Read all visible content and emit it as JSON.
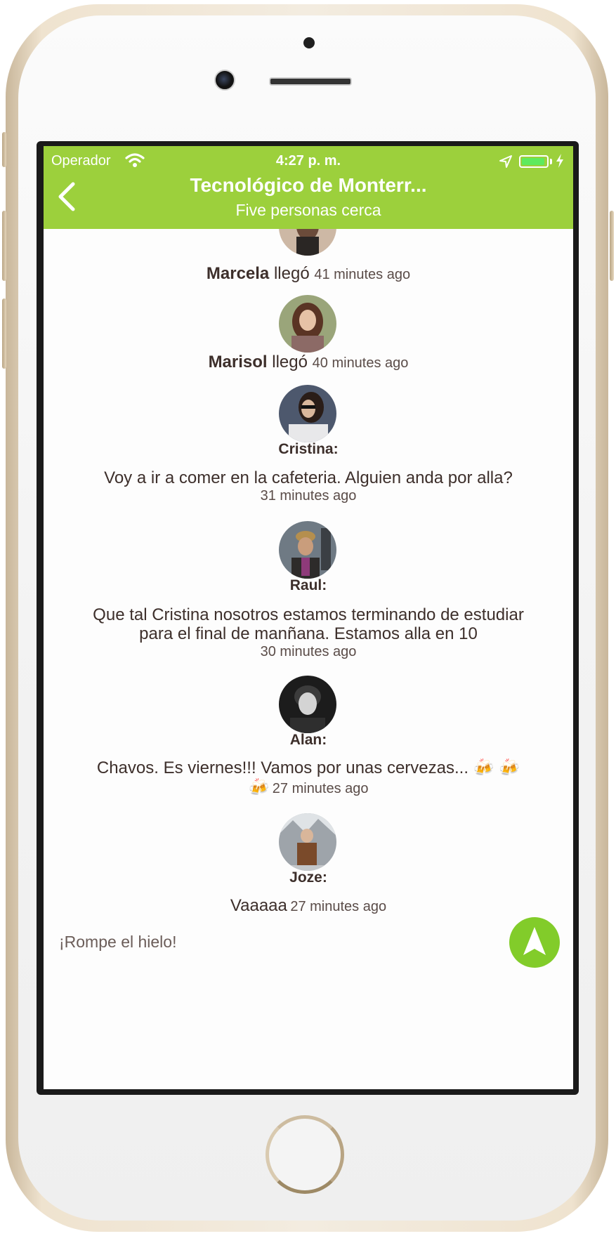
{
  "status_bar": {
    "carrier": "Operador",
    "time": "4:27 p. m."
  },
  "header": {
    "title": "Tecnológico de Monterr...",
    "subtitle": "Five personas cerca"
  },
  "feed": [
    {
      "type": "arrival",
      "name": "Marcela",
      "text": "llegó",
      "time": "41 minutes ago"
    },
    {
      "type": "arrival",
      "name": "Marisol",
      "text": "llegó",
      "time": "40 minutes ago"
    },
    {
      "type": "message",
      "sender": "Cristina:",
      "text": "Voy a ir a comer en la cafeteria. Alguien anda por alla?",
      "time": "31 minutes ago"
    },
    {
      "type": "message",
      "sender": "Raul:",
      "text_lines": [
        "Que tal Cristina nosotros estamos terminando de estudiar",
        "para el final de manñana. Estamos alla en 10"
      ],
      "time": "30 minutes ago"
    },
    {
      "type": "message",
      "sender": "Alan:",
      "text": "Chavos. Es viernes!!! Vamos por unas cervezas...",
      "emoji": "🍻",
      "time": "27 minutes ago"
    },
    {
      "type": "message",
      "sender": "Joze:",
      "text": "Vaaaaa",
      "time": "27 minutes ago"
    }
  ],
  "composer": {
    "placeholder": "¡Rompe el hielo!"
  },
  "colors": {
    "accent": "#9cd03c",
    "send_button": "#82cc2a",
    "text": "#3d2f2b"
  },
  "icons": {
    "back": "chevron-left-icon",
    "send": "navigation-arrow-icon",
    "wifi": "wifi-icon",
    "location": "location-arrow-icon",
    "battery": "battery-icon"
  }
}
